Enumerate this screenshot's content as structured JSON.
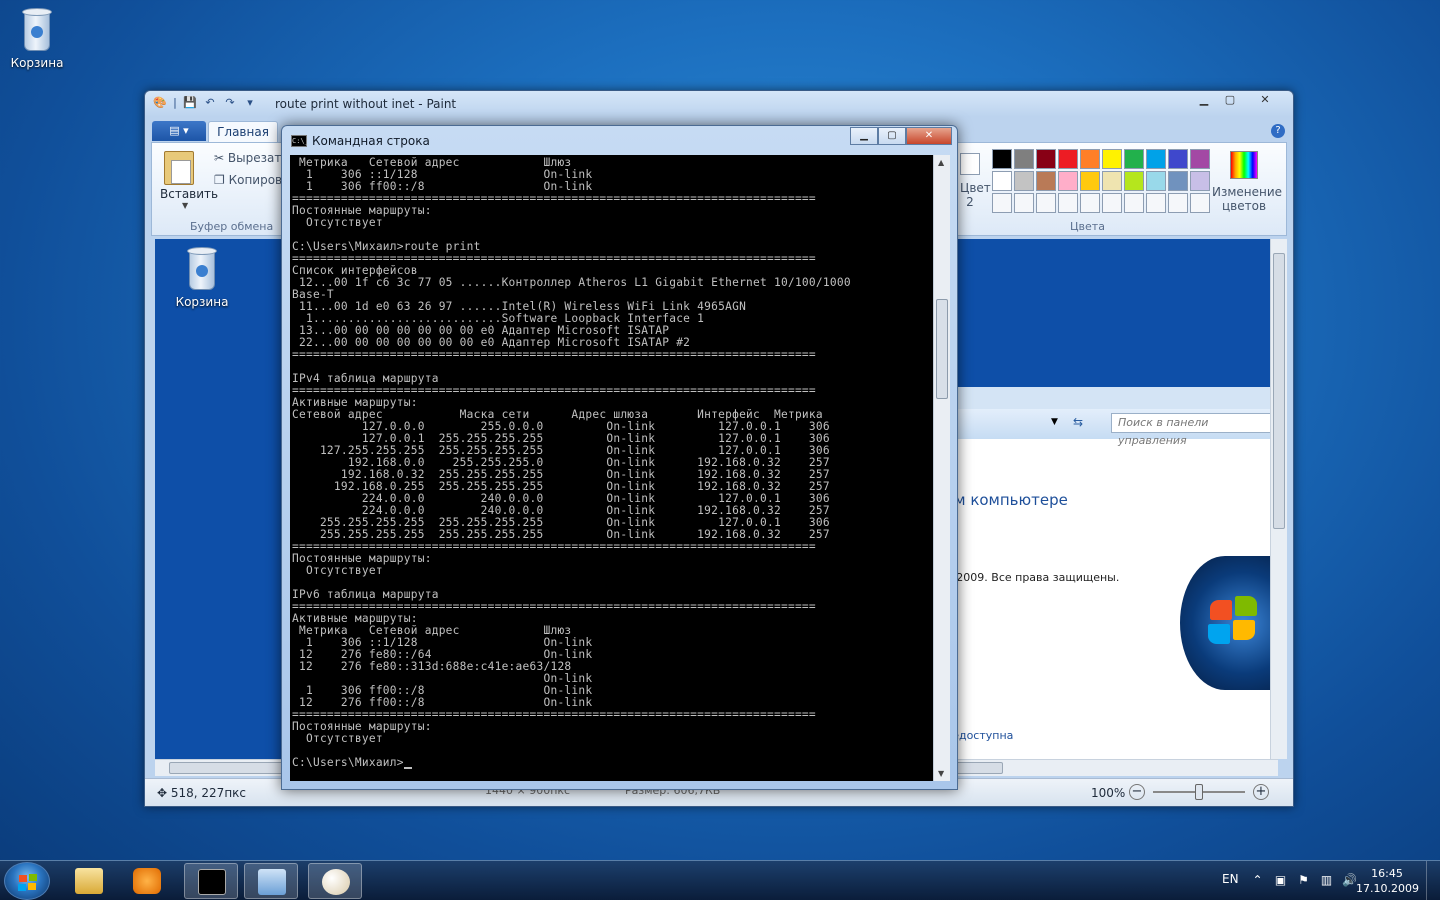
{
  "desktop": {
    "recycle_bin_label": "Корзина"
  },
  "paint": {
    "title": "route print without inet - Paint",
    "tabs": {
      "file": "▤ ▾",
      "home": "Главная"
    },
    "clipboard": {
      "paste": "Вставить",
      "cut": "Вырезать",
      "copy": "Копировать",
      "group": "Буфер обмена"
    },
    "colors": {
      "group": "Цвета",
      "color2": "Цвет 2",
      "edit_colors": "Изменение цветов",
      "palette": [
        "#000000",
        "#7f7f7f",
        "#880015",
        "#ed1c24",
        "#ff7f27",
        "#fff200",
        "#22b14c",
        "#00a2e8",
        "#3f48cc",
        "#a349a4",
        "#ffffff",
        "#c3c3c3",
        "#b97a57",
        "#ffaec9",
        "#ffc90e",
        "#efe4b0",
        "#b5e61d",
        "#99d9ea",
        "#7092be",
        "#c8bfe7",
        "#f5f7fa",
        "#f5f7fa",
        "#f5f7fa",
        "#f5f7fa",
        "#f5f7fa",
        "#f5f7fa",
        "#f5f7fa",
        "#f5f7fa",
        "#f5f7fa",
        "#f5f7fa"
      ]
    },
    "canvas": {
      "inner_bin_label": "Корзина",
      "search_placeholder": "Поиск в панели управления",
      "heading": "ем компьютере",
      "copyright": "), 2009. Все права защищены.",
      "link": "недоступна"
    },
    "status": {
      "cursor": "518, 227пкс",
      "selection": "1440 × 900пкс",
      "size": "Размер: 606,7КБ",
      "zoom": "100%"
    }
  },
  "cmd": {
    "title": "Командная строка",
    "lines": [
      " Метрика   Сетевой адрес            Шлюз",
      "  1    306 ::1/128                  On-link",
      "  1    306 ff00::/8                 On-link",
      "===========================================================================",
      "Постоянные маршруты:",
      "  Отсутствует",
      "",
      "C:\\Users\\Михаил>route print",
      "===========================================================================",
      "Список интерфейсов",
      " 12...00 1f c6 3c 77 05 ......Контроллер Atheros L1 Gigabit Ethernet 10/100/1000",
      "Base-T",
      " 11...00 1d e0 63 26 97 ......Intel(R) Wireless WiFi Link 4965AGN",
      "  1...........................Software Loopback Interface 1",
      " 13...00 00 00 00 00 00 00 e0 Адаптер Microsoft ISATAP",
      " 22...00 00 00 00 00 00 00 e0 Адаптер Microsoft ISATAP #2",
      "===========================================================================",
      "",
      "IPv4 таблица маршрута",
      "===========================================================================",
      "Активные маршруты:",
      "Сетевой адрес           Маска сети      Адрес шлюза       Интерфейс  Метрика",
      "          127.0.0.0        255.0.0.0         On-link         127.0.0.1    306",
      "          127.0.0.1  255.255.255.255         On-link         127.0.0.1    306",
      "    127.255.255.255  255.255.255.255         On-link         127.0.0.1    306",
      "        192.168.0.0    255.255.255.0         On-link      192.168.0.32    257",
      "       192.168.0.32  255.255.255.255         On-link      192.168.0.32    257",
      "      192.168.0.255  255.255.255.255         On-link      192.168.0.32    257",
      "          224.0.0.0        240.0.0.0         On-link         127.0.0.1    306",
      "          224.0.0.0        240.0.0.0         On-link      192.168.0.32    257",
      "    255.255.255.255  255.255.255.255         On-link         127.0.0.1    306",
      "    255.255.255.255  255.255.255.255         On-link      192.168.0.32    257",
      "===========================================================================",
      "Постоянные маршруты:",
      "  Отсутствует",
      "",
      "IPv6 таблица маршрута",
      "===========================================================================",
      "Активные маршруты:",
      " Метрика   Сетевой адрес            Шлюз",
      "  1    306 ::1/128                  On-link",
      " 12    276 fe80::/64                On-link",
      " 12    276 fe80::313d:688e:c41e:ae63/128",
      "                                    On-link",
      "  1    306 ff00::/8                 On-link",
      " 12    276 ff00::/8                 On-link",
      "===========================================================================",
      "Постоянные маршруты:",
      "  Отсутствует",
      ""
    ],
    "prompt": "C:\\Users\\Михаил>"
  },
  "taskbar": {
    "lang": "EN",
    "time": "16:45",
    "date": "17.10.2009"
  }
}
